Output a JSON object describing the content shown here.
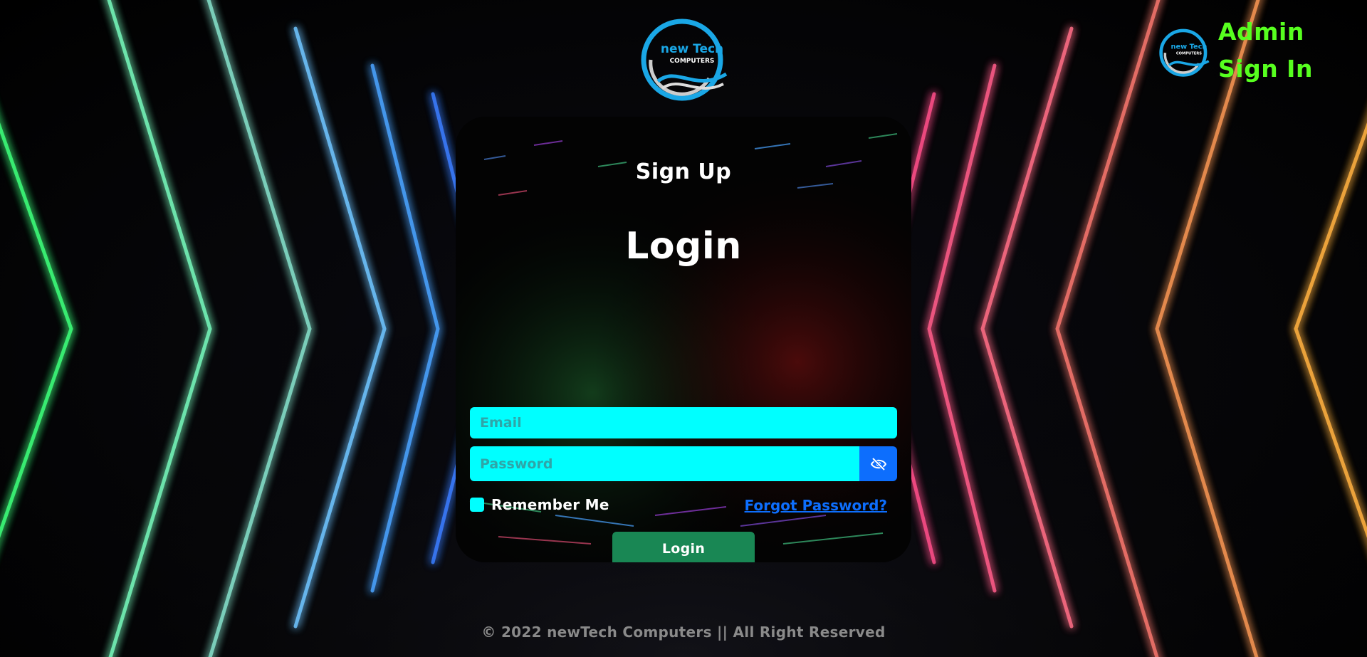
{
  "brand": {
    "logo_line1": "new Tech",
    "logo_line2": "COMPUTERS",
    "icon": "newtech-computers-logo"
  },
  "admin": {
    "admin_label": "Admin",
    "sign_in_label": "Sign In"
  },
  "card": {
    "signup_label": "Sign Up",
    "title": "Login",
    "email": {
      "placeholder": "Email",
      "value": ""
    },
    "password": {
      "placeholder": "Password",
      "value": "",
      "toggle_icon": "eye-slash-icon"
    },
    "remember_label": "Remember Me",
    "remember_checked": false,
    "forgot_label": "Forgot Password?",
    "login_button": "Login"
  },
  "footer": {
    "copyright": "© 2022 newTech Computers || All Right Reserved"
  },
  "colors": {
    "input_bg": "#00ffff",
    "admin_link": "#57ff1f",
    "login_button": "#198754",
    "eye_button": "#0d6efd",
    "forgot_link": "#0d6efd"
  }
}
